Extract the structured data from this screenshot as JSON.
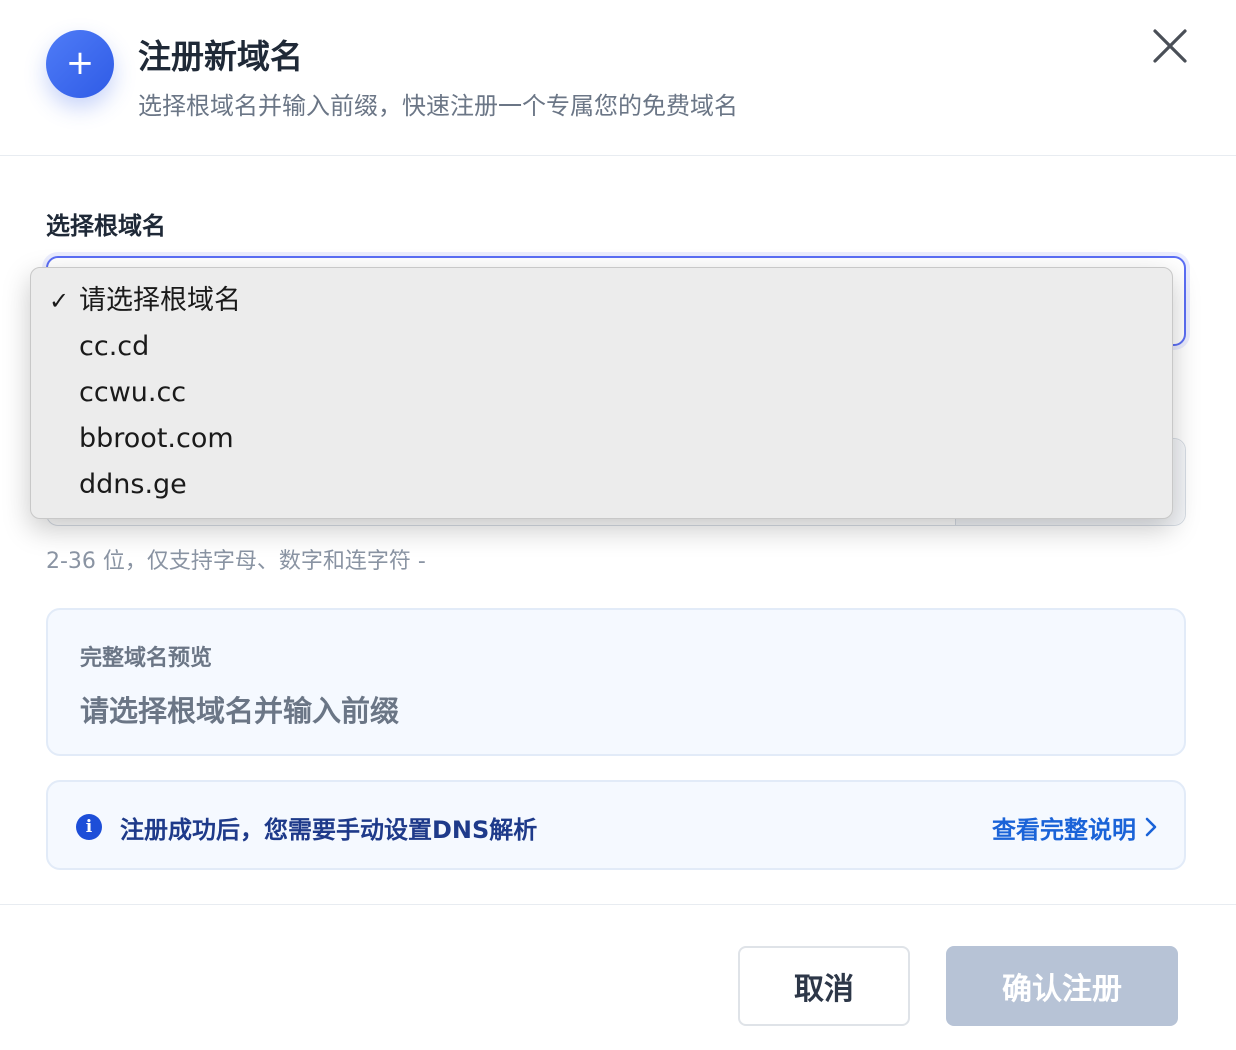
{
  "header": {
    "title": "注册新域名",
    "subtitle": "选择根域名并输入前缀，快速注册一个专属您的免费域名",
    "icon": "plus-icon",
    "icon_glyph": "+",
    "close_icon": "close-icon"
  },
  "form": {
    "root_label": "选择根域名",
    "hint": "2-36 位，仅支持字母、数字和连字符 -"
  },
  "dropdown": {
    "selected_index": 0,
    "check_glyph": "✓",
    "options": [
      "请选择根域名",
      "cc.cd",
      "ccwu.cc",
      "bbroot.com",
      "ddns.ge"
    ]
  },
  "preview": {
    "label": "完整域名预览",
    "value": "请选择根域名并输入前缀"
  },
  "notice": {
    "icon": "info-icon",
    "icon_glyph": "i",
    "text": "注册成功后，您需要手动设置DNS解析",
    "link": "查看完整说明",
    "link_icon": "chevron-right-icon"
  },
  "footer": {
    "cancel_label": "取消",
    "confirm_label": "确认注册"
  },
  "colors": {
    "accent": "#3b64eb",
    "focus_border": "#5b6ef5",
    "link": "#1a63d8",
    "confirm_disabled": "#b7c3d6"
  }
}
